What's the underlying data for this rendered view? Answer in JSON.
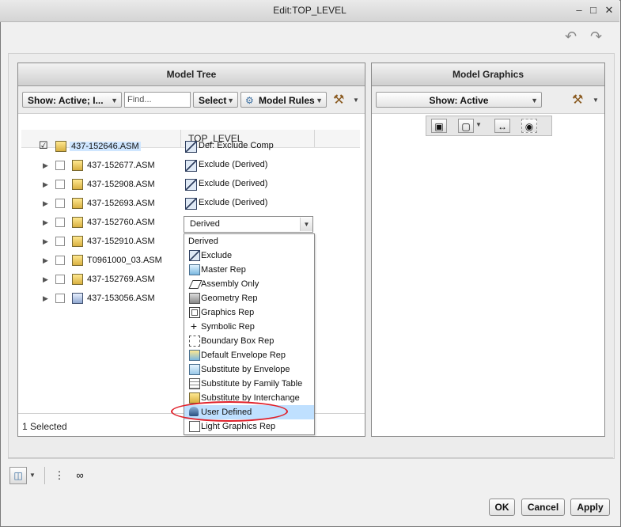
{
  "window": {
    "title": "Edit:TOP_LEVEL",
    "minimize": "–",
    "maximize": "□",
    "close": "✕"
  },
  "model_tree": {
    "title": "Model Tree",
    "show_label": "Show: Active; I...",
    "find_placeholder": "Find...",
    "select_label": "Select",
    "model_rules_label": "Model Rules",
    "column_header": "TOP_LEVEL",
    "rows": [
      {
        "name": "437-152646.ASM",
        "rep": "Def: Exclude Comp",
        "checked": true,
        "expandable": false,
        "selected": true
      },
      {
        "name": "437-152677.ASM",
        "rep": "Exclude (Derived)",
        "checked": false,
        "expandable": true,
        "selected": false
      },
      {
        "name": "437-152908.ASM",
        "rep": "Exclude (Derived)",
        "checked": false,
        "expandable": true,
        "selected": false
      },
      {
        "name": "437-152693.ASM",
        "rep": "Exclude (Derived)",
        "checked": false,
        "expandable": true,
        "selected": false
      },
      {
        "name": "437-152760.ASM",
        "rep": "",
        "checked": false,
        "expandable": true,
        "selected": false
      },
      {
        "name": "437-152910.ASM",
        "rep": "",
        "checked": false,
        "expandable": true,
        "selected": false
      },
      {
        "name": "T0961000_03.ASM",
        "rep": "",
        "checked": false,
        "expandable": true,
        "selected": false
      },
      {
        "name": "437-152769.ASM",
        "rep": "",
        "checked": false,
        "expandable": true,
        "selected": false
      },
      {
        "name": "437-153056.ASM",
        "rep": "",
        "checked": false,
        "expandable": true,
        "selected": false
      }
    ],
    "footer": "1 Selected"
  },
  "dropdown": {
    "value": "Derived",
    "options": [
      {
        "label": "Derived",
        "icon": "none"
      },
      {
        "label": "Exclude",
        "icon": "exclude-icon"
      },
      {
        "label": "Master Rep",
        "icon": "master-rep-icon"
      },
      {
        "label": "Assembly Only",
        "icon": "assembly-only-icon"
      },
      {
        "label": "Geometry Rep",
        "icon": "geometry-rep-icon"
      },
      {
        "label": "Graphics Rep",
        "icon": "graphics-rep-icon"
      },
      {
        "label": "Symbolic Rep",
        "icon": "symbolic-rep-icon"
      },
      {
        "label": "Boundary Box Rep",
        "icon": "boundary-box-icon"
      },
      {
        "label": "Default Envelope Rep",
        "icon": "envelope-icon"
      },
      {
        "label": "Substitute by Envelope",
        "icon": "substitute-envelope-icon"
      },
      {
        "label": "Substitute by Family Table",
        "icon": "family-table-icon"
      },
      {
        "label": "Substitute by Interchange",
        "icon": "interchange-icon"
      },
      {
        "label": "User Defined",
        "icon": "user-defined-icon"
      },
      {
        "label": "Light Graphics Rep",
        "icon": "light-graphics-icon"
      }
    ],
    "highlighted_index": 12,
    "accent_color": "#e0202a"
  },
  "model_graphics": {
    "title": "Model Graphics",
    "show_label": "Show: Active"
  },
  "buttons": {
    "ok": "OK",
    "cancel": "Cancel",
    "apply": "Apply"
  }
}
